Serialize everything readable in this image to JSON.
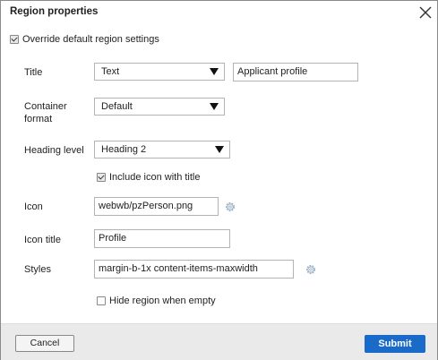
{
  "dialog": {
    "title": "Region properties",
    "close_icon": "close-x-icon"
  },
  "override": {
    "label": "Override default region settings",
    "checked": true
  },
  "fields": {
    "title": {
      "label": "Title",
      "source_value": "Text",
      "value": "Applicant profile"
    },
    "container_format": {
      "label_line1": "Container",
      "label_line2": "format",
      "value": "Default"
    },
    "heading_level": {
      "label": "Heading level",
      "value": "Heading 2"
    },
    "include_icon": {
      "label": "Include icon with title",
      "checked": true
    },
    "icon": {
      "label": "Icon",
      "value": "webwb/pzPerson.png",
      "picker_icon": "gear-icon"
    },
    "icon_title": {
      "label": "Icon title",
      "value": "Profile"
    },
    "styles": {
      "label": "Styles",
      "value": "margin-b-1x content-items-maxwidth",
      "picker_icon": "gear-icon"
    },
    "hide_when_empty": {
      "label": "Hide region when empty",
      "checked": false
    }
  },
  "footer": {
    "cancel_label": "Cancel",
    "submit_label": "Submit"
  },
  "colors": {
    "accent": "#1a6ac9",
    "footer_bg": "#eaeaea",
    "gear": "#9fb4c8"
  }
}
